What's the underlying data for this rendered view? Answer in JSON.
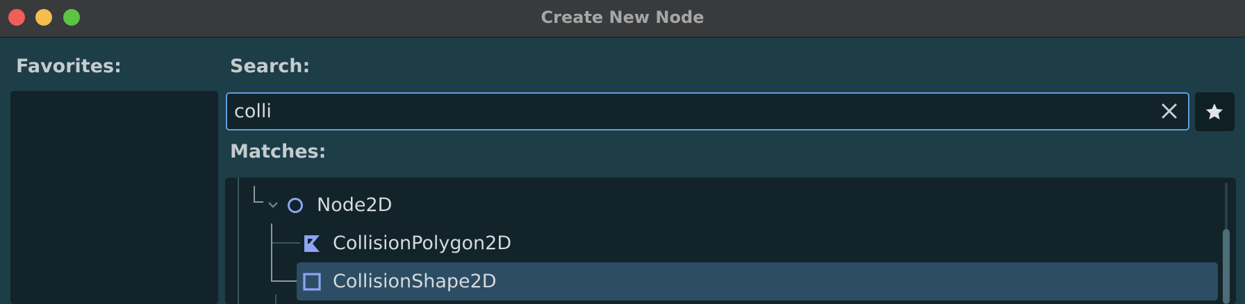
{
  "window": {
    "title": "Create New Node",
    "controls": {
      "close_color": "#ee5f57",
      "minimize_color": "#f4bd4e",
      "maximize_color": "#5cc443"
    }
  },
  "favorites": {
    "label": "Favorites:",
    "items": []
  },
  "search": {
    "label": "Search:",
    "value": "colli",
    "clear_icon": "close-icon",
    "favorite_icon": "star-icon"
  },
  "matches": {
    "label": "Matches:",
    "tree": [
      {
        "label": "Node2D",
        "icon": "node2d-circle-icon",
        "expanded": true,
        "selected": false
      },
      {
        "label": "CollisionPolygon2D",
        "icon": "collision-polygon-icon",
        "selected": false
      },
      {
        "label": "CollisionShape2D",
        "icon": "collision-shape-icon",
        "selected": true
      }
    ]
  },
  "colors": {
    "background": "#1d3d47",
    "panel": "#122329",
    "accent": "#5d9fe0",
    "selection": "#2c4d63",
    "icon_tint": "#8da5f3"
  }
}
